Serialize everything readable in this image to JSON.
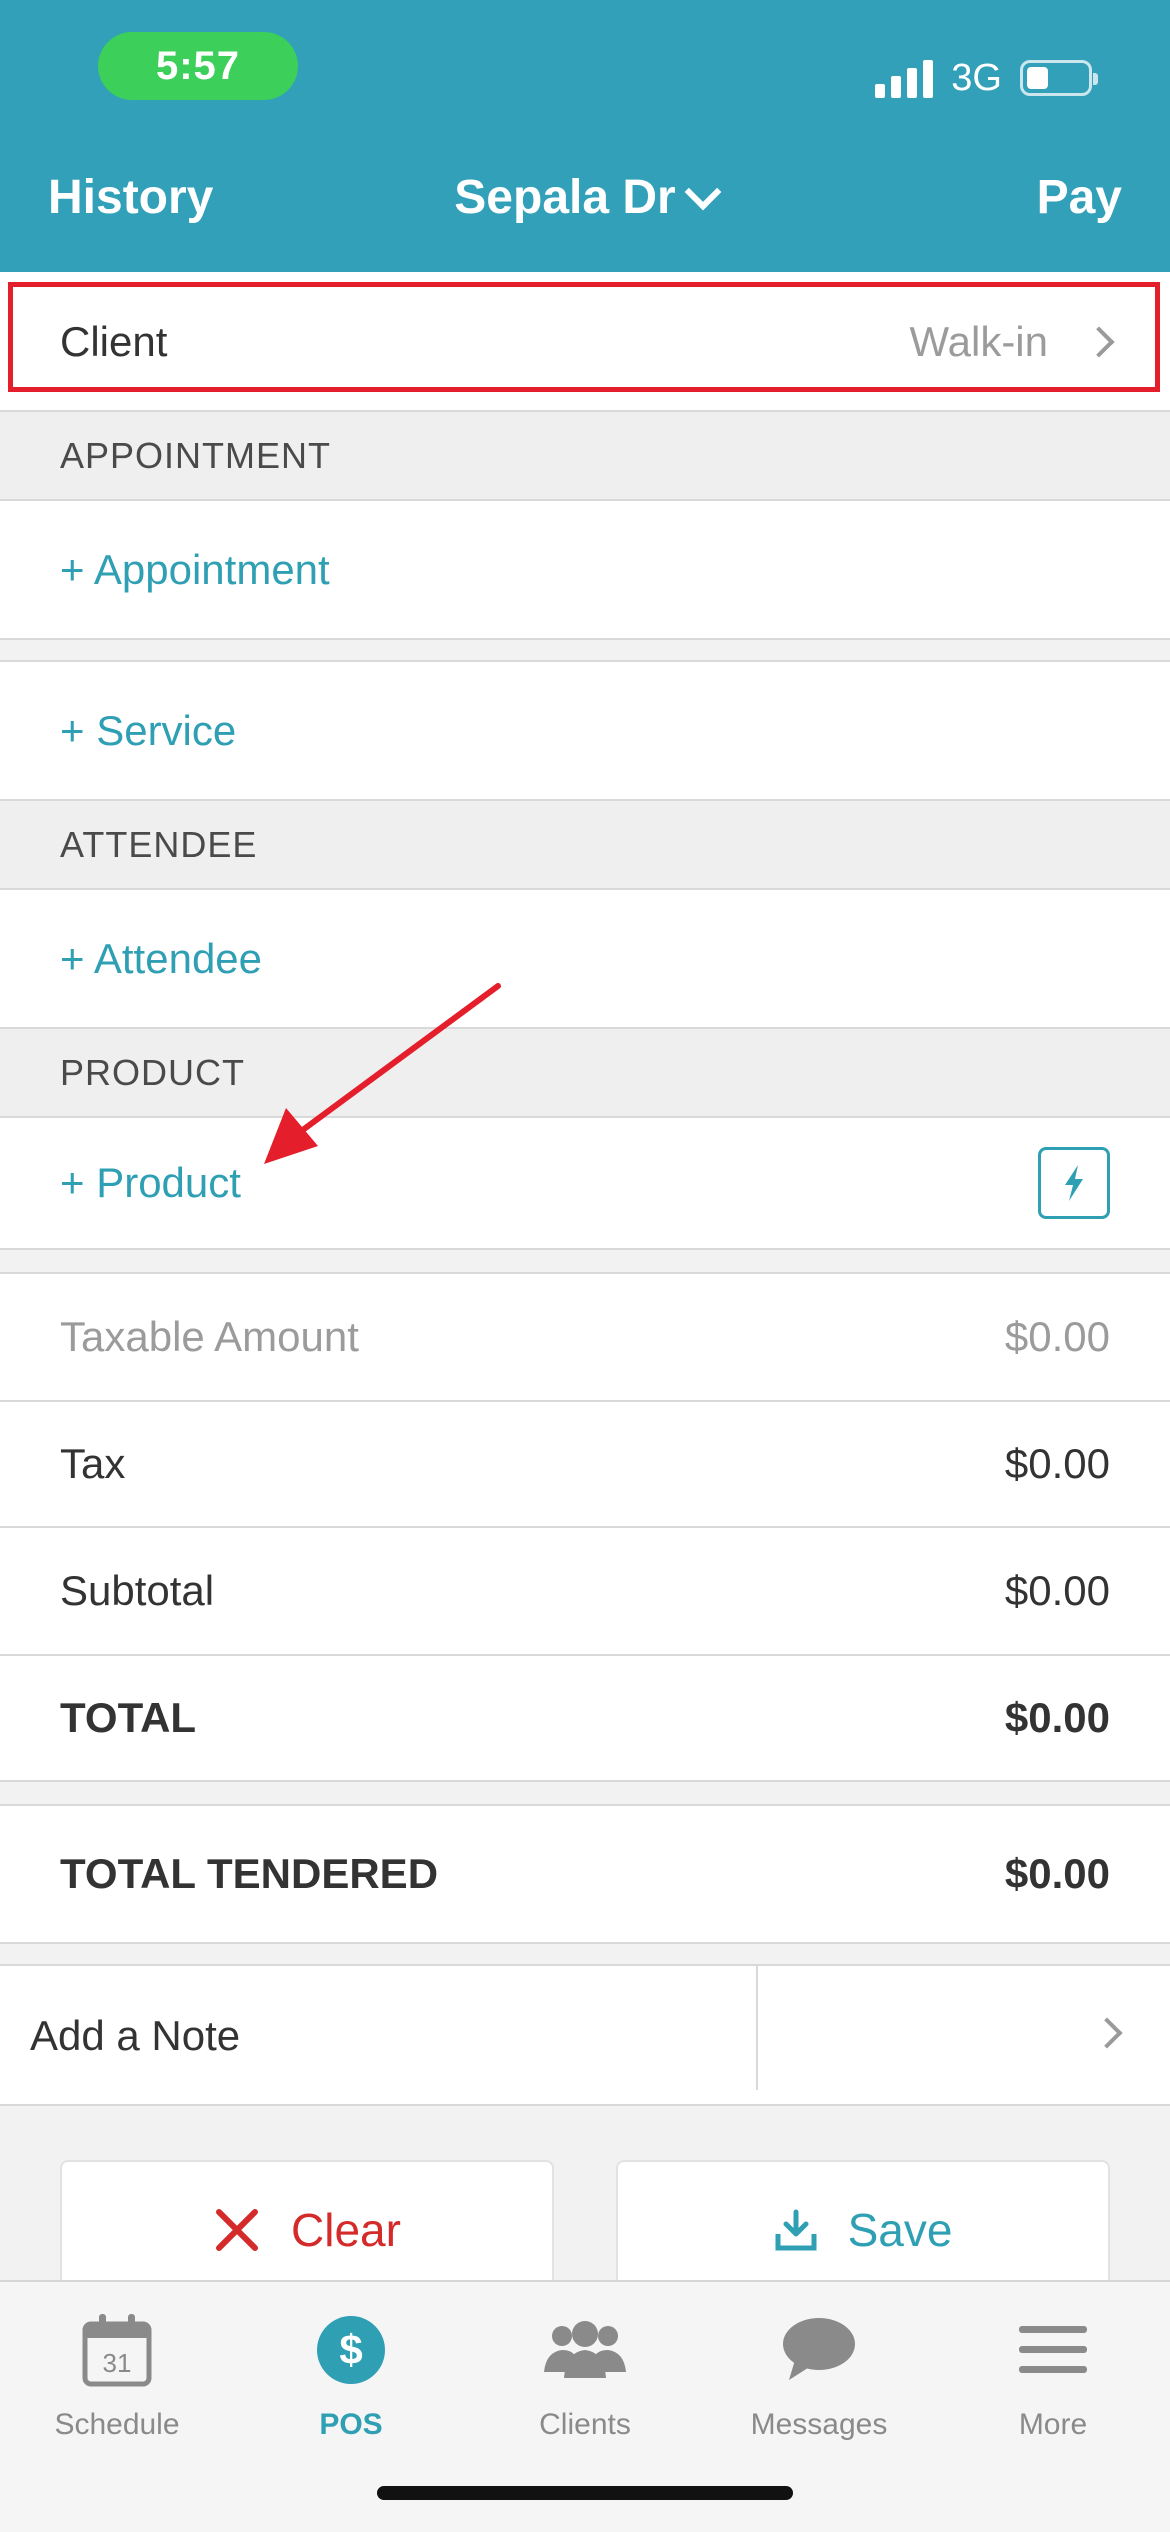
{
  "status_bar": {
    "time": "5:57",
    "network": "3G",
    "battery_level": 0.3
  },
  "nav": {
    "left": "History",
    "center": "Sepala Dr",
    "right": "Pay"
  },
  "client": {
    "label": "Client",
    "value": "Walk-in"
  },
  "sections": {
    "appointment_header": "APPOINTMENT",
    "appointment_add": "+ Appointment",
    "service_add": "+ Service",
    "attendee_header": "ATTENDEE",
    "attendee_add": "+ Attendee",
    "product_header": "PRODUCT",
    "product_add": "+ Product"
  },
  "totals": {
    "taxable_label": "Taxable Amount",
    "taxable_value": "$0.00",
    "tax_label": "Tax",
    "tax_value": "$0.00",
    "subtotal_label": "Subtotal",
    "subtotal_value": "$0.00",
    "total_label": "TOTAL",
    "total_value": "$0.00",
    "tendered_label": "TOTAL TENDERED",
    "tendered_value": "$0.00"
  },
  "note": {
    "label": "Add a Note"
  },
  "actions": {
    "clear": "Clear",
    "save": "Save"
  },
  "tabs": [
    {
      "label": "Schedule",
      "icon": "calendar-icon",
      "day": "31"
    },
    {
      "label": "POS",
      "icon": "dollar-icon",
      "active": true
    },
    {
      "label": "Clients",
      "icon": "clients-icon"
    },
    {
      "label": "Messages",
      "icon": "messages-icon"
    },
    {
      "label": "More",
      "icon": "menu-icon"
    }
  ],
  "colors": {
    "header": "#31a0b8",
    "accent": "#2f9fb4",
    "annotation": "#e41e2a",
    "clear": "#d42a2a"
  }
}
